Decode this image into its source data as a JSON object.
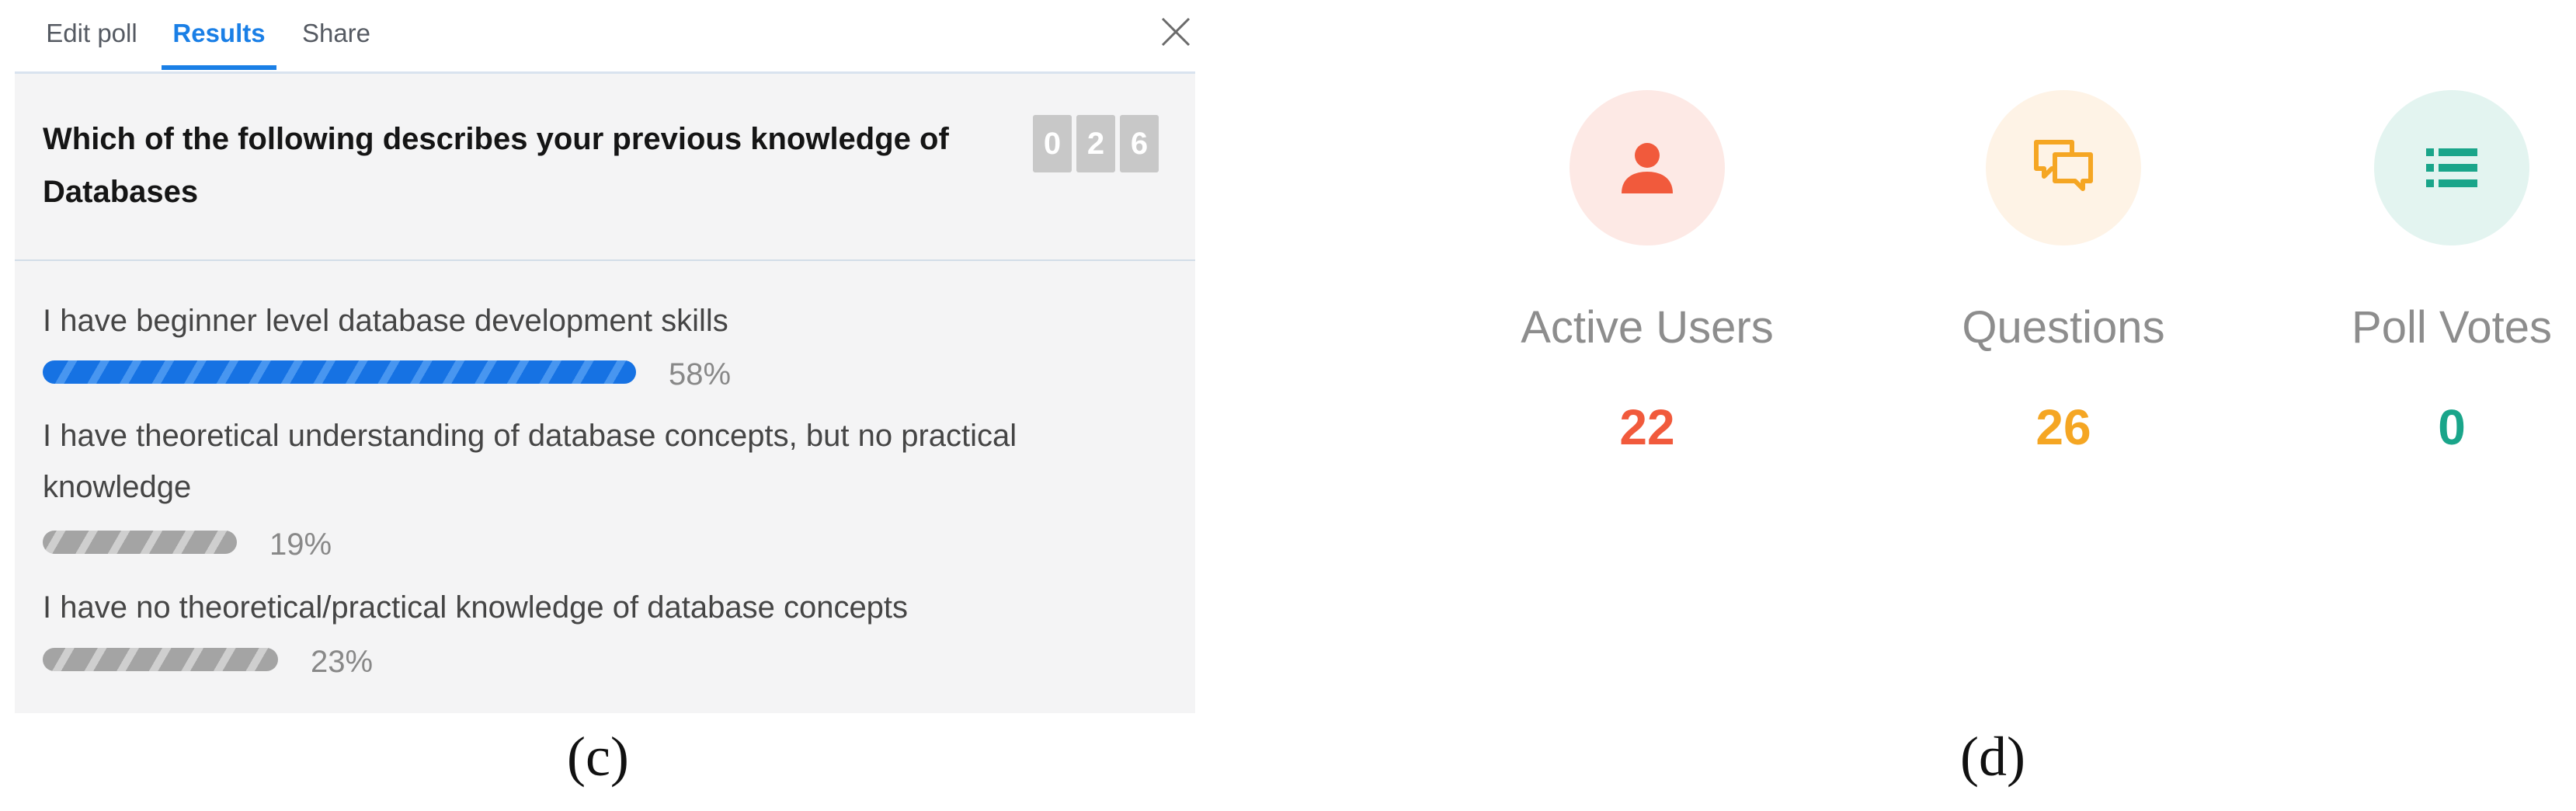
{
  "tabs": {
    "edit_poll": "Edit poll",
    "results": "Results",
    "share": "Share"
  },
  "poll": {
    "question": "Which of the following describes your previous knowledge of Databases",
    "vote_counter_digits": [
      "0",
      "2",
      "6"
    ],
    "options": [
      {
        "label": "I have beginner level database development skills",
        "percent_text": "58%",
        "fraction": 0.58,
        "bar_color": "#1672e3"
      },
      {
        "label": "I have theoretical understanding of database concepts, but no practical knowledge",
        "percent_text": "19%",
        "fraction": 0.19,
        "bar_color": "#a4a4a4"
      },
      {
        "label": "I have no theoretical/practical knowledge of database concepts",
        "percent_text": "23%",
        "fraction": 0.23,
        "bar_color": "#a4a4a4"
      }
    ]
  },
  "captions": {
    "left": "(c)",
    "right": "(d)"
  },
  "stats": [
    {
      "label": "Active Users",
      "value": "22",
      "color": "#f15a3c",
      "circle_color": "#fde9e5",
      "icon": "user-icon"
    },
    {
      "label": "Questions",
      "value": "26",
      "color": "#f5a623",
      "circle_color": "#fef3e6",
      "icon": "chat-bubbles-icon"
    },
    {
      "label": "Poll Votes",
      "value": "0",
      "color": "#1aa58a",
      "circle_color": "#e3f4f0",
      "icon": "list-icon"
    }
  ],
  "colors": {
    "accent": "#1a7fe6"
  }
}
